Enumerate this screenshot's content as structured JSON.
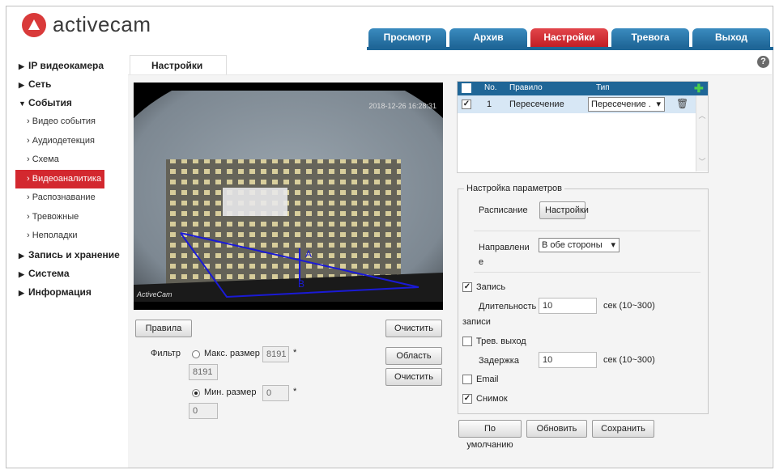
{
  "brand": {
    "name": "activecam"
  },
  "topnav": {
    "tabs": [
      {
        "label": "Просмотр"
      },
      {
        "label": "Архив"
      },
      {
        "label": "Настройки"
      },
      {
        "label": "Тревога"
      },
      {
        "label": "Выход"
      }
    ],
    "active": "Настройки"
  },
  "sidebar": {
    "ip_camera": "IP видеокамера",
    "network": "Сеть",
    "events": "События",
    "event_items": [
      "Видео события",
      "Аудиодетекция",
      "Схема",
      "Видеоаналитика",
      "Распознавание",
      "Тревожные",
      "Неполадки"
    ],
    "active_item": "Видеоаналитика",
    "recording": "Запись и хранение",
    "system": "Система",
    "info": "Информация"
  },
  "page": {
    "tab": "Настройки",
    "help_icon": "?"
  },
  "video": {
    "timestamp": "2018-12-26 16:28:31",
    "osd": "ActiveCam",
    "overlay_labels": {
      "a": "A",
      "b": "B"
    }
  },
  "left_controls": {
    "rules_button": "Правила",
    "clear_button_1": "Очистить",
    "area_button": "Область",
    "clear_button_2": "Очистить",
    "filter_label": "Фильтр",
    "max_size_label": "Макс. размер",
    "max_size_value": "8191",
    "max_size_value2": "8191",
    "min_size_label": "Мин. размер",
    "min_size_value": "0",
    "min_size_value2": "0",
    "asterisk": "*",
    "selected_filter": "min"
  },
  "rules_table": {
    "headers": {
      "no": "No.",
      "rule": "Правило",
      "type": "Тип"
    },
    "rows": [
      {
        "checked": true,
        "no": "1",
        "rule": "Пересечение",
        "type": "Пересечение ."
      }
    ]
  },
  "params": {
    "legend": "Настройка параметров",
    "schedule_label": "Расписание",
    "schedule_button": "Настройки",
    "direction_label_1": "Направлени",
    "direction_label_2": "е",
    "direction_value": "В обе стороны",
    "record_label": "Запись",
    "record_checked": true,
    "duration_label_1": "Длительность",
    "duration_label_2": "записи",
    "duration_value": "10",
    "duration_hint": "сек (10~300)",
    "alarm_out_label": "Трев. выход",
    "alarm_out_checked": false,
    "delay_label": "Задержка",
    "delay_value": "10",
    "delay_hint": "сек (10~300)",
    "email_label": "Email",
    "email_checked": false,
    "snapshot_label": "Снимок",
    "snapshot_checked": true
  },
  "bottom_buttons": {
    "default": "По умолчанию",
    "refresh": "Обновить",
    "save": "Сохранить"
  },
  "colors": {
    "blue": "#1f6697",
    "red": "#c21f26",
    "line": "#1a1ad6"
  }
}
